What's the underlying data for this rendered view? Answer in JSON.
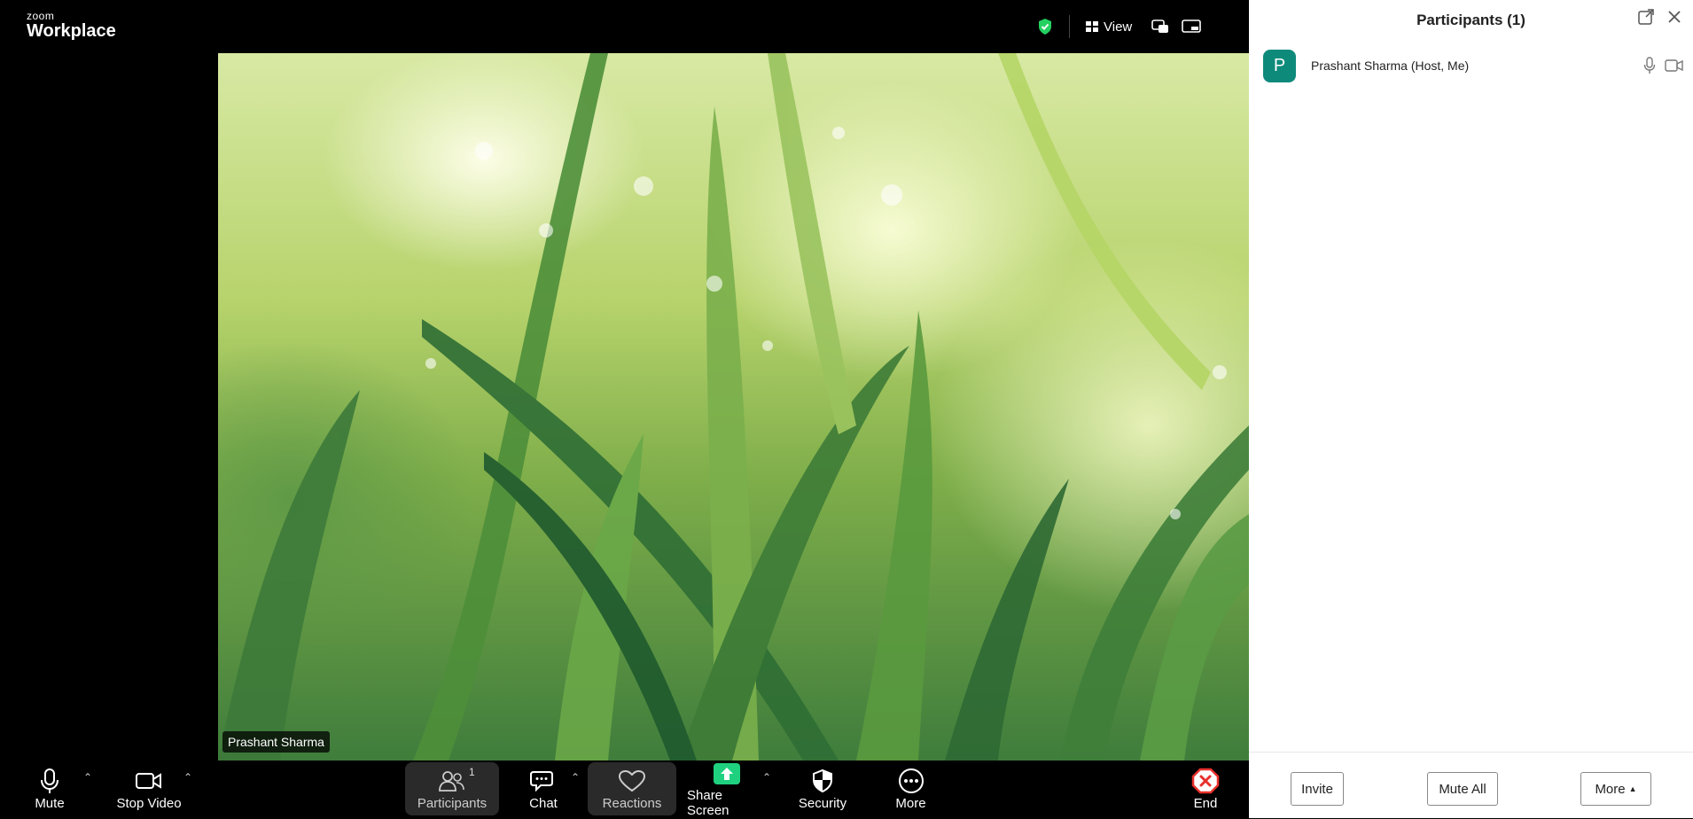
{
  "app": {
    "logo_small": "zoom",
    "logo_big": "Workplace"
  },
  "topbar": {
    "view_label": "View",
    "icons": [
      "shield-check-icon",
      "view-grid-icon",
      "picture-in-picture-icon",
      "minimize-icon"
    ],
    "shield_color": "#23d160"
  },
  "video": {
    "participant_name": "Prashant Sharma"
  },
  "toolbar": {
    "mute": "Mute",
    "stop_video": "Stop Video",
    "participants": "Participants",
    "participants_count": "1",
    "chat": "Chat",
    "reactions": "Reactions",
    "share_screen": "Share Screen",
    "security": "Security",
    "more": "More",
    "end": "End",
    "share_color": "#1fd17f",
    "end_color": "#e8302b"
  },
  "panel": {
    "title": "Participants (1)",
    "participants": [
      {
        "initial": "P",
        "name": "Prashant Sharma (Host, Me)",
        "avatar_color": "#0e8a7b"
      }
    ],
    "invite": "Invite",
    "mute_all": "Mute All",
    "more": "More"
  }
}
